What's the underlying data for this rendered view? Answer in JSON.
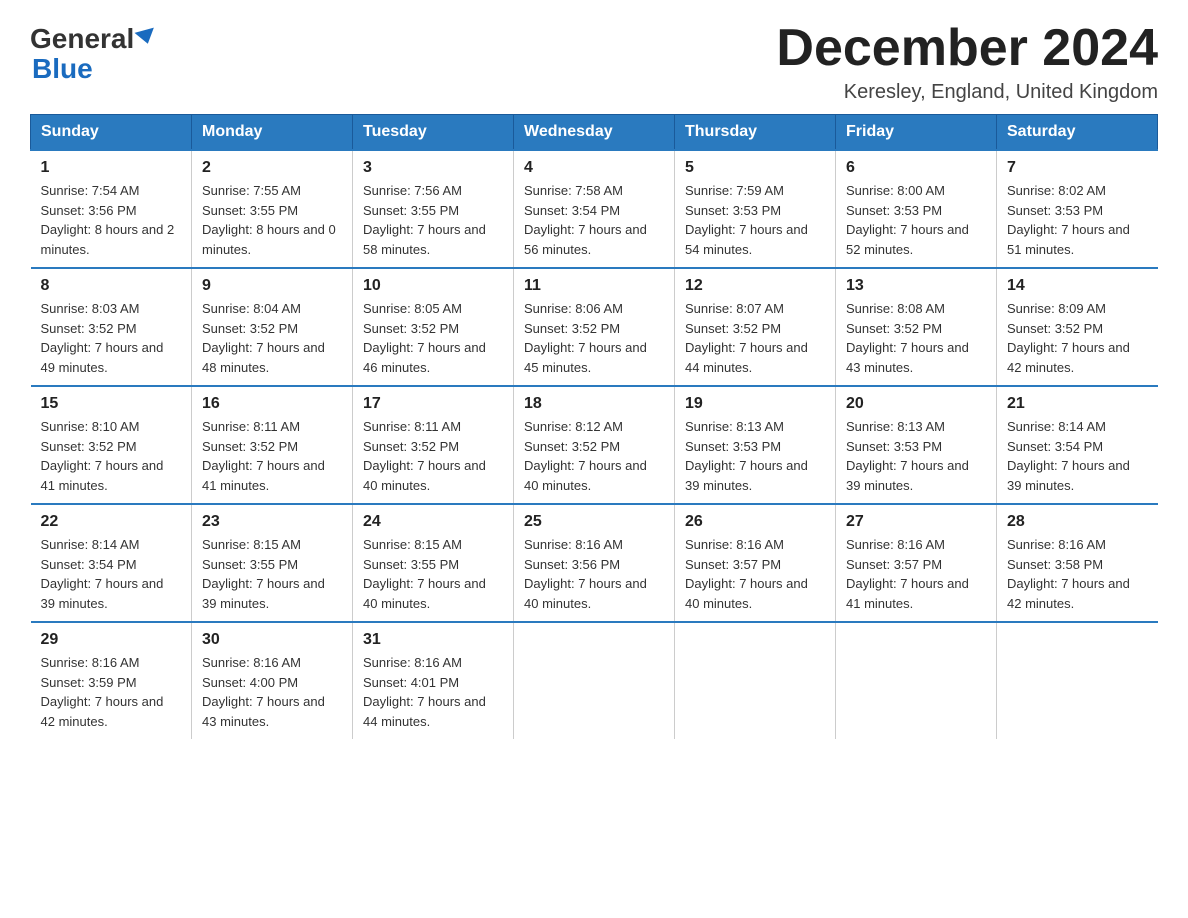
{
  "header": {
    "logo_line1": "General",
    "logo_line2": "Blue",
    "month_title": "December 2024",
    "location": "Keresley, England, United Kingdom"
  },
  "weekdays": [
    "Sunday",
    "Monday",
    "Tuesday",
    "Wednesday",
    "Thursday",
    "Friday",
    "Saturday"
  ],
  "weeks": [
    [
      {
        "day": "1",
        "sunrise": "7:54 AM",
        "sunset": "3:56 PM",
        "daylight": "8 hours and 2 minutes."
      },
      {
        "day": "2",
        "sunrise": "7:55 AM",
        "sunset": "3:55 PM",
        "daylight": "8 hours and 0 minutes."
      },
      {
        "day": "3",
        "sunrise": "7:56 AM",
        "sunset": "3:55 PM",
        "daylight": "7 hours and 58 minutes."
      },
      {
        "day": "4",
        "sunrise": "7:58 AM",
        "sunset": "3:54 PM",
        "daylight": "7 hours and 56 minutes."
      },
      {
        "day": "5",
        "sunrise": "7:59 AM",
        "sunset": "3:53 PM",
        "daylight": "7 hours and 54 minutes."
      },
      {
        "day": "6",
        "sunrise": "8:00 AM",
        "sunset": "3:53 PM",
        "daylight": "7 hours and 52 minutes."
      },
      {
        "day": "7",
        "sunrise": "8:02 AM",
        "sunset": "3:53 PM",
        "daylight": "7 hours and 51 minutes."
      }
    ],
    [
      {
        "day": "8",
        "sunrise": "8:03 AM",
        "sunset": "3:52 PM",
        "daylight": "7 hours and 49 minutes."
      },
      {
        "day": "9",
        "sunrise": "8:04 AM",
        "sunset": "3:52 PM",
        "daylight": "7 hours and 48 minutes."
      },
      {
        "day": "10",
        "sunrise": "8:05 AM",
        "sunset": "3:52 PM",
        "daylight": "7 hours and 46 minutes."
      },
      {
        "day": "11",
        "sunrise": "8:06 AM",
        "sunset": "3:52 PM",
        "daylight": "7 hours and 45 minutes."
      },
      {
        "day": "12",
        "sunrise": "8:07 AM",
        "sunset": "3:52 PM",
        "daylight": "7 hours and 44 minutes."
      },
      {
        "day": "13",
        "sunrise": "8:08 AM",
        "sunset": "3:52 PM",
        "daylight": "7 hours and 43 minutes."
      },
      {
        "day": "14",
        "sunrise": "8:09 AM",
        "sunset": "3:52 PM",
        "daylight": "7 hours and 42 minutes."
      }
    ],
    [
      {
        "day": "15",
        "sunrise": "8:10 AM",
        "sunset": "3:52 PM",
        "daylight": "7 hours and 41 minutes."
      },
      {
        "day": "16",
        "sunrise": "8:11 AM",
        "sunset": "3:52 PM",
        "daylight": "7 hours and 41 minutes."
      },
      {
        "day": "17",
        "sunrise": "8:11 AM",
        "sunset": "3:52 PM",
        "daylight": "7 hours and 40 minutes."
      },
      {
        "day": "18",
        "sunrise": "8:12 AM",
        "sunset": "3:52 PM",
        "daylight": "7 hours and 40 minutes."
      },
      {
        "day": "19",
        "sunrise": "8:13 AM",
        "sunset": "3:53 PM",
        "daylight": "7 hours and 39 minutes."
      },
      {
        "day": "20",
        "sunrise": "8:13 AM",
        "sunset": "3:53 PM",
        "daylight": "7 hours and 39 minutes."
      },
      {
        "day": "21",
        "sunrise": "8:14 AM",
        "sunset": "3:54 PM",
        "daylight": "7 hours and 39 minutes."
      }
    ],
    [
      {
        "day": "22",
        "sunrise": "8:14 AM",
        "sunset": "3:54 PM",
        "daylight": "7 hours and 39 minutes."
      },
      {
        "day": "23",
        "sunrise": "8:15 AM",
        "sunset": "3:55 PM",
        "daylight": "7 hours and 39 minutes."
      },
      {
        "day": "24",
        "sunrise": "8:15 AM",
        "sunset": "3:55 PM",
        "daylight": "7 hours and 40 minutes."
      },
      {
        "day": "25",
        "sunrise": "8:16 AM",
        "sunset": "3:56 PM",
        "daylight": "7 hours and 40 minutes."
      },
      {
        "day": "26",
        "sunrise": "8:16 AM",
        "sunset": "3:57 PM",
        "daylight": "7 hours and 40 minutes."
      },
      {
        "day": "27",
        "sunrise": "8:16 AM",
        "sunset": "3:57 PM",
        "daylight": "7 hours and 41 minutes."
      },
      {
        "day": "28",
        "sunrise": "8:16 AM",
        "sunset": "3:58 PM",
        "daylight": "7 hours and 42 minutes."
      }
    ],
    [
      {
        "day": "29",
        "sunrise": "8:16 AM",
        "sunset": "3:59 PM",
        "daylight": "7 hours and 42 minutes."
      },
      {
        "day": "30",
        "sunrise": "8:16 AM",
        "sunset": "4:00 PM",
        "daylight": "7 hours and 43 minutes."
      },
      {
        "day": "31",
        "sunrise": "8:16 AM",
        "sunset": "4:01 PM",
        "daylight": "7 hours and 44 minutes."
      },
      null,
      null,
      null,
      null
    ]
  ]
}
